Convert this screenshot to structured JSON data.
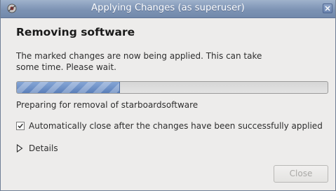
{
  "window": {
    "title": "Applying Changes (as superuser)"
  },
  "dialog": {
    "heading": "Removing software",
    "description": "The marked changes are now being applied. This can take some time. Please wait.",
    "progress": {
      "fraction": 0.33
    },
    "status": "Preparing for removal of starboardsoftware",
    "auto_close": {
      "label": "Automatically close after the changes have been successfully applied",
      "checked": true
    },
    "details_label": "Details",
    "close_button": {
      "label": "Close",
      "enabled": false
    }
  },
  "colors": {
    "titlebar": "#7d93b4",
    "progress_fill": "#6e90c4",
    "window_bg": "#edeceb"
  },
  "icons": {
    "title_icon": "app-icon",
    "close": "close-icon",
    "checkbox": "checkmark-icon",
    "expander": "triangle-right-icon"
  }
}
